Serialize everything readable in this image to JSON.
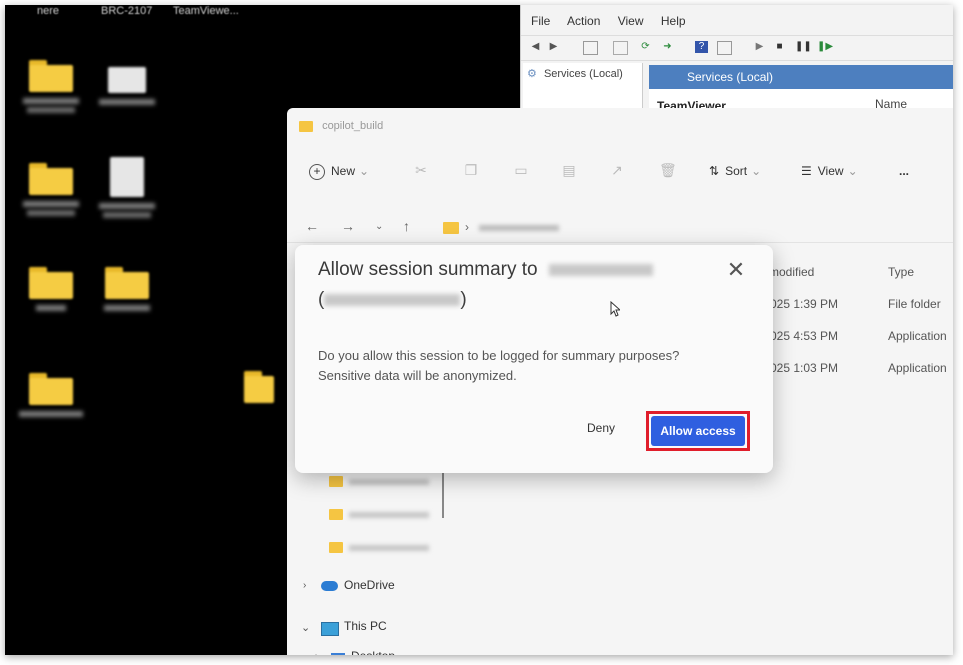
{
  "desktop": {
    "top_labels": [
      "nere",
      "BRC-2107",
      "TeamViewe..."
    ]
  },
  "services": {
    "menu": [
      "File",
      "Action",
      "View",
      "Help"
    ],
    "tree_item": "Services (Local)",
    "banner": "Services (Local)",
    "section": "TeamViewer",
    "column": "Name"
  },
  "explorer": {
    "title": "copilot_build",
    "toolbar": {
      "new": "New",
      "sort": "Sort",
      "view": "View",
      "more": "..."
    },
    "columns": {
      "modified": "modified",
      "type": "Type"
    },
    "rows": [
      {
        "date": "025 1:39 PM",
        "type": "File folder"
      },
      {
        "date": "025 4:53 PM",
        "type": "Application"
      },
      {
        "date": "025 1:03 PM",
        "type": "Application"
      }
    ],
    "sidebar": {
      "onedrive": "OneDrive",
      "thispc": "This PC",
      "desktop": "Desktop"
    }
  },
  "dialog": {
    "title_prefix": "Allow session summary to",
    "body_line1": "Do you allow this session to be logged for summary purposes?",
    "body_line2": "Sensitive data will be anonymized.",
    "deny_label": "Deny",
    "allow_label": "Allow access"
  },
  "colors": {
    "allow_button": "#2f5fe0",
    "highlight_border": "#e01e2b",
    "services_banner": "#4d7fbf",
    "folder": "#f5c542"
  }
}
